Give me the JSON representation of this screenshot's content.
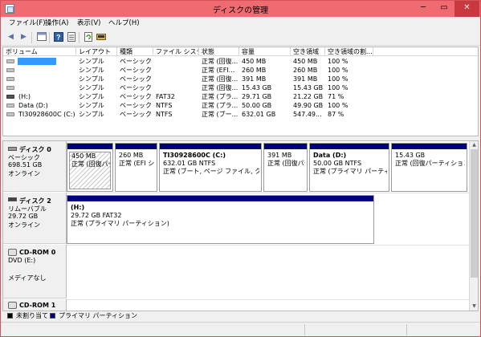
{
  "window": {
    "title": "ディスクの管理"
  },
  "menu": [
    "ファイル(F)",
    "操作(A)",
    "表示(V)",
    "ヘルプ(H)"
  ],
  "toolbar": {
    "buttons": [
      "back-arrow-icon",
      "forward-arrow-icon",
      "console-icon",
      "help-icon",
      "properties-icon",
      "refresh-icon",
      "disk-settings-icon"
    ]
  },
  "volume_list": {
    "columns": [
      "ボリューム",
      "レイアウト",
      "種類",
      "ファイル システム",
      "状態",
      "容量",
      "空き領域",
      "空き領域の割..."
    ],
    "rows": [
      {
        "name": "",
        "layout": "シンプル",
        "type": "ベーシック",
        "fs": "",
        "status": "正常 (回復...",
        "capacity": "450 MB",
        "free": "450 MB",
        "pct": "100 %",
        "selected": true,
        "icon": "drive-icon"
      },
      {
        "name": "",
        "layout": "シンプル",
        "type": "ベーシック",
        "fs": "",
        "status": "正常 (EFI...",
        "capacity": "260 MB",
        "free": "260 MB",
        "pct": "100 %",
        "selected": false,
        "icon": "drive-icon"
      },
      {
        "name": "",
        "layout": "シンプル",
        "type": "ベーシック",
        "fs": "",
        "status": "正常 (回復...",
        "capacity": "391 MB",
        "free": "391 MB",
        "pct": "100 %",
        "selected": false,
        "icon": "drive-icon"
      },
      {
        "name": "",
        "layout": "シンプル",
        "type": "ベーシック",
        "fs": "",
        "status": "正常 (回復...",
        "capacity": "15.43 GB",
        "free": "15.43 GB",
        "pct": "100 %",
        "selected": false,
        "icon": "drive-icon"
      },
      {
        "name": "(H:)",
        "layout": "シンプル",
        "type": "ベーシック",
        "fs": "FAT32",
        "status": "正常 (プラ...",
        "capacity": "29.71 GB",
        "free": "21.22 GB",
        "pct": "71 %",
        "selected": false,
        "icon": "removable-drive-icon"
      },
      {
        "name": "Data (D:)",
        "layout": "シンプル",
        "type": "ベーシック",
        "fs": "NTFS",
        "status": "正常 (プラ...",
        "capacity": "50.00 GB",
        "free": "49.90 GB",
        "pct": "100 %",
        "selected": false,
        "icon": "drive-icon"
      },
      {
        "name": "TI30928600C (C:)",
        "layout": "シンプル",
        "type": "ベーシック",
        "fs": "NTFS",
        "status": "正常 (ブー...",
        "capacity": "632.01 GB",
        "free": "547.49...",
        "pct": "87 %",
        "selected": false,
        "icon": "drive-icon"
      }
    ]
  },
  "disks": [
    {
      "title": "ディスク 0",
      "lines": [
        "ベーシック",
        "698.51 GB",
        "オンライン"
      ],
      "partitions": [
        {
          "title": "",
          "lines": [
            "450 MB",
            "正常 (回復パーテ"
          ],
          "hatched": true
        },
        {
          "title": "",
          "lines": [
            "260 MB",
            "正常 (EFI シ"
          ],
          "hatched": false
        },
        {
          "title": "TI30928600C  (C:)",
          "lines": [
            "632.01 GB NTFS",
            "正常 (ブート, ページ ファイル, クラッシュ"
          ],
          "hatched": false
        },
        {
          "title": "",
          "lines": [
            "391 MB",
            "正常 (回復パー"
          ],
          "hatched": false
        },
        {
          "title": "Data  (D:)",
          "lines": [
            "50.00 GB NTFS",
            "正常 (プライマリ パーティション"
          ],
          "hatched": false
        },
        {
          "title": "",
          "lines": [
            "15.43 GB",
            "正常 (回復パーティション"
          ],
          "hatched": false
        }
      ]
    },
    {
      "title": "ディスク 2",
      "lines": [
        "リムーバブル",
        "29.72 GB",
        "オンライン"
      ],
      "partitions": [
        {
          "title": "(H:)",
          "lines": [
            "29.72 GB FAT32",
            "正常 (プライマリ パーティション)"
          ],
          "hatched": false
        }
      ]
    },
    {
      "title": "CD-ROM 0",
      "lines": [
        "DVD (E:)",
        "",
        "メディアなし"
      ],
      "partitions": []
    },
    {
      "title": "CD-ROM 1",
      "lines": [],
      "partitions": []
    }
  ],
  "legend": [
    {
      "label": "未割り当て",
      "color": "#000000"
    },
    {
      "label": "プライマリ パーティション",
      "color": "#00007f"
    }
  ],
  "colors": {
    "titlebar": "#f06a72",
    "close": "#c7383f",
    "partition_header": "#00007f",
    "selection": "#3399ff"
  }
}
